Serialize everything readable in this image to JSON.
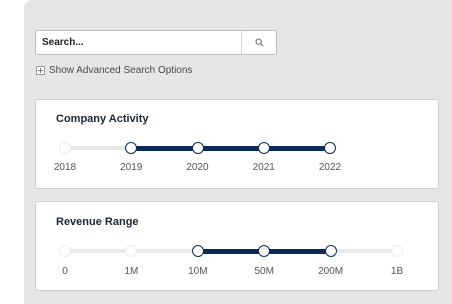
{
  "search": {
    "placeholder": "Search...",
    "button_icon": "magnifier-icon",
    "advanced_toggle_label": "Show Advanced Search Options"
  },
  "company_activity": {
    "title": "Company Activity",
    "labels": [
      "2018",
      "2019",
      "2020",
      "2021",
      "2022"
    ],
    "selected_start_index": 1,
    "selected_end_index": 4
  },
  "revenue_range": {
    "title": "Revenue Range",
    "labels": [
      "0",
      "1M",
      "10M",
      "50M",
      "200M",
      "1B"
    ],
    "selected_start_index": 2,
    "selected_end_index": 4
  },
  "colors": {
    "accent": "#0b2a5a",
    "panel_bg": "#e6e6e6",
    "track": "#e8e8e8"
  }
}
